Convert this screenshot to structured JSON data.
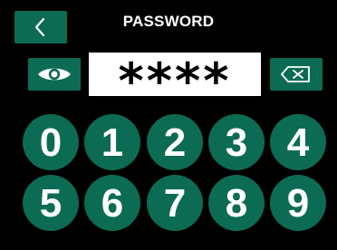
{
  "header": {
    "title": "PASSWORD",
    "back_icon": "chevron-left-icon"
  },
  "password": {
    "value_masked": "****",
    "visibility_icon": "eye-icon",
    "delete_icon": "backspace-icon"
  },
  "keypad": {
    "digits": [
      "0",
      "1",
      "2",
      "3",
      "4",
      "5",
      "6",
      "7",
      "8",
      "9"
    ]
  },
  "colors": {
    "background": "#000000",
    "accent": "#0c6b53",
    "input_background": "#ffffff",
    "text_primary": "#ffffff",
    "text_input": "#000000"
  }
}
